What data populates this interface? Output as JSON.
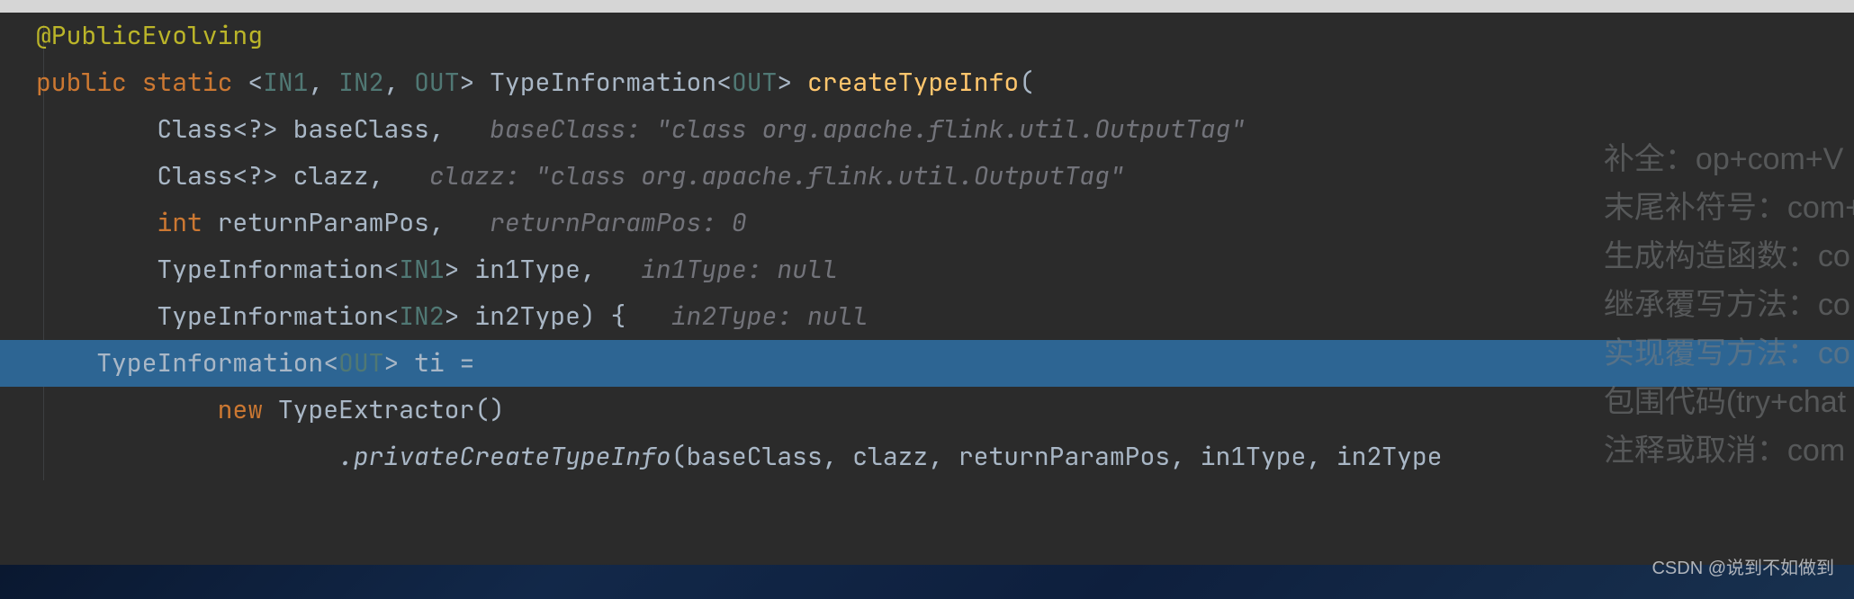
{
  "code": {
    "annotation": "@PublicEvolving",
    "modifiers": {
      "public": "public",
      "static": "static"
    },
    "generics": {
      "open": "<",
      "in1": "IN1",
      "in2": "IN2",
      "out": "OUT",
      "sep": ", ",
      "close": ">"
    },
    "returnType": "TypeInformation",
    "methodName": "createTypeInfo",
    "params": {
      "p1": {
        "type": "Class",
        "wild": "<?>",
        "name": "baseClass",
        "hintLabel": "baseClass:",
        "hintVal": "\"class org.apache.flink.util.OutputTag\""
      },
      "p2": {
        "type": "Class",
        "wild": "<?>",
        "name": "clazz",
        "hintLabel": "clazz:",
        "hintVal": "\"class org.apache.flink.util.OutputTag\""
      },
      "p3": {
        "type": "int",
        "name": "returnParamPos",
        "hintLabel": "returnParamPos:",
        "hintVal": "0"
      },
      "p4": {
        "type": "TypeInformation",
        "gen": "IN1",
        "name": "in1Type",
        "hintLabel": "in1Type:",
        "hintVal": "null"
      },
      "p5": {
        "type": "TypeInformation",
        "gen": "IN2",
        "name": "in2Type",
        "hintLabel": "in2Type:",
        "hintVal": "null"
      }
    },
    "body": {
      "decl": {
        "type": "TypeInformation",
        "gen": "OUT",
        "var": "ti",
        "eq": " ="
      },
      "newKw": "new",
      "ctor": "TypeExtractor",
      "call": ".privateCreateTypeInfo",
      "args": "baseClass, clazz, returnParamPos, in1Type, in2Type"
    },
    "punc": {
      "lparen": "(",
      "rparen": ")",
      "comma": ",",
      "lbrace": "{",
      "langle": "<",
      "rangle": ">"
    }
  },
  "hints": {
    "l1": "补全：op+com+V",
    "l2": "末尾补符号：com+",
    "l3": "生成构造函数：co",
    "l4": "继承覆写方法：co",
    "l5": "实现覆写方法：co",
    "l6": "包围代码(try+chat",
    "l7": "注释或取消：com"
  },
  "watermark": "CSDN @说到不如做到"
}
